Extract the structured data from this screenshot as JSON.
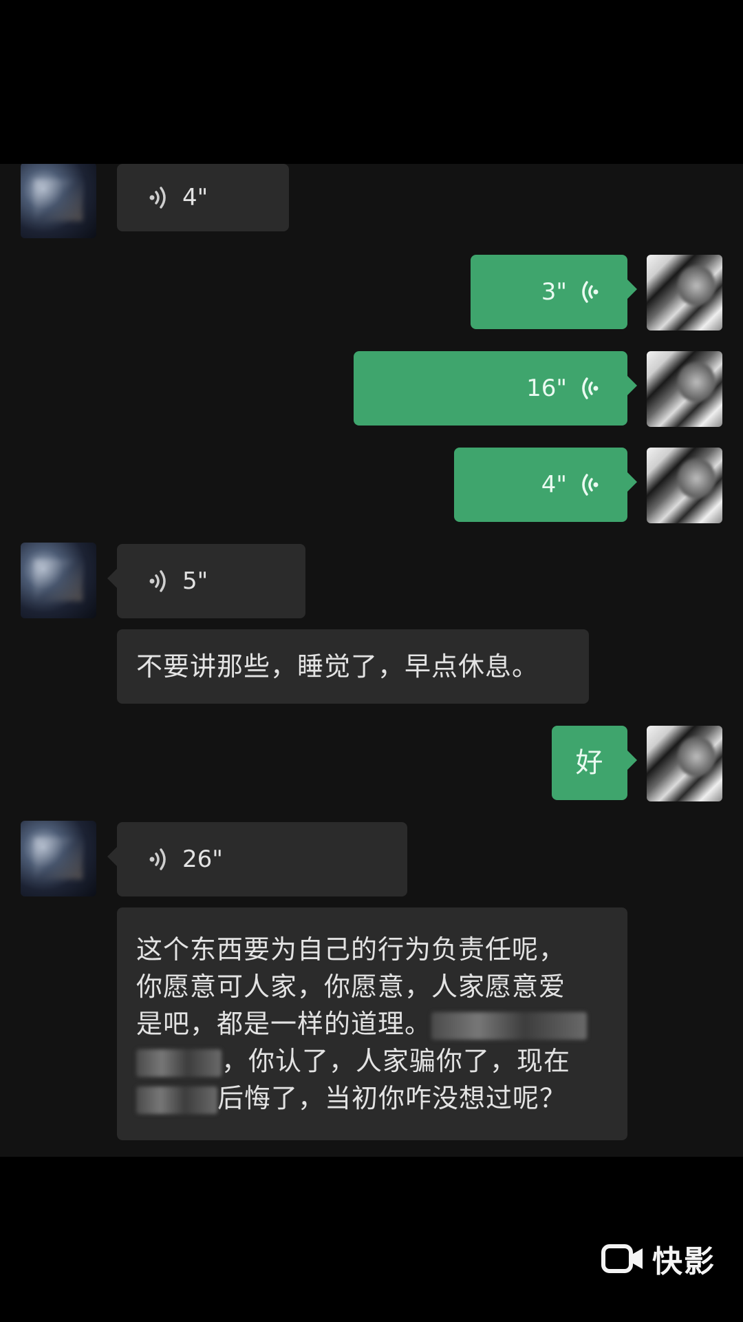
{
  "messages": [
    {
      "side": "in",
      "type": "voice",
      "duration": "4\""
    },
    {
      "side": "out",
      "type": "voice",
      "duration": "3\""
    },
    {
      "side": "out",
      "type": "voice",
      "duration": "16\""
    },
    {
      "side": "out",
      "type": "voice",
      "duration": "4\""
    },
    {
      "side": "in",
      "type": "voice",
      "duration": "5\""
    },
    {
      "side": "in",
      "type": "text",
      "text": "不要讲那些，睡觉了，早点休息。"
    },
    {
      "side": "out",
      "type": "text",
      "text": "好"
    },
    {
      "side": "in",
      "type": "voice",
      "duration": "26\""
    },
    {
      "side": "in",
      "type": "text",
      "lines": [
        "这个东西要为自己的行为负责任呢，",
        "你愿意可人家，你愿意，人家愿意爱",
        "是吧，都是一样的道理。",
        "，你认了，人家骗你了，现在",
        "后悔了，当初你咋没想过呢？"
      ]
    }
  ],
  "icons": {
    "voice_wave": "voice-wave-icon",
    "watermark_logo": "kuaiying-logo-icon"
  },
  "colors": {
    "outgoing_bubble": "#3fa56d",
    "incoming_bubble": "#2b2b2b",
    "chat_background": "#121212"
  },
  "watermark": {
    "text": "快影"
  }
}
